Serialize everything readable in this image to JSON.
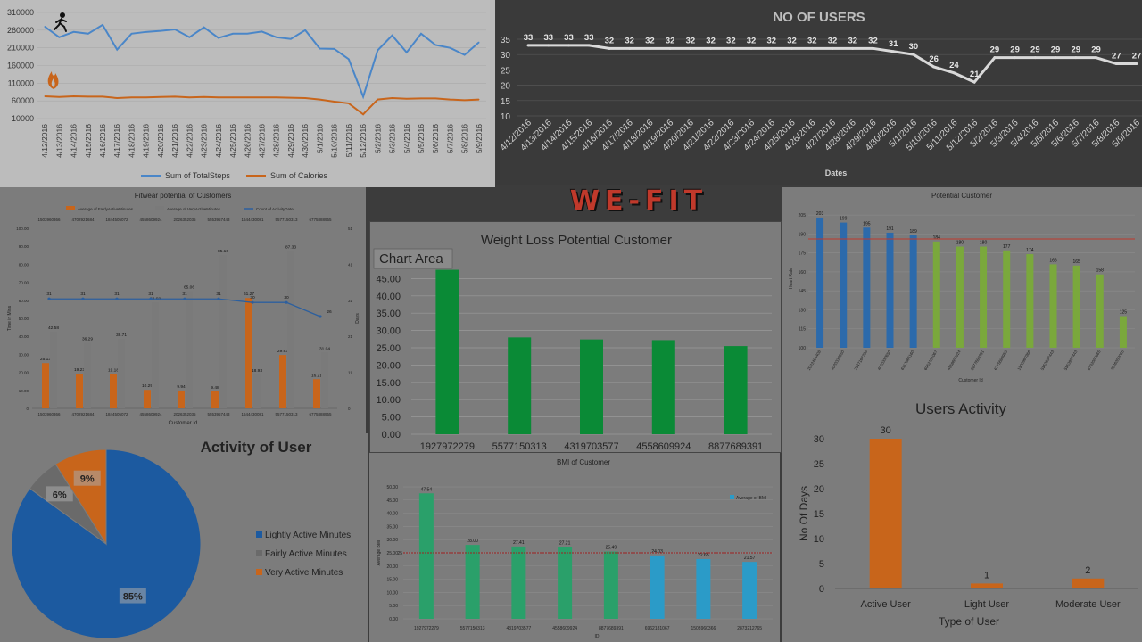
{
  "logo_text": "WE-FIT",
  "chart_data": [
    {
      "id": "steps_calories",
      "type": "line",
      "categories": [
        "4/12/2016",
        "4/13/2016",
        "4/14/2016",
        "4/15/2016",
        "4/16/2016",
        "4/17/2016",
        "4/18/2016",
        "4/19/2016",
        "4/20/2016",
        "4/21/2016",
        "4/22/2016",
        "4/23/2016",
        "4/24/2016",
        "4/25/2016",
        "4/26/2016",
        "4/27/2016",
        "4/28/2016",
        "4/29/2016",
        "4/30/2016",
        "5/1/2016",
        "5/10/2016",
        "5/11/2016",
        "5/12/2016",
        "5/2/2016",
        "5/3/2016",
        "5/4/2016",
        "5/5/2016",
        "5/6/2016",
        "5/7/2016",
        "5/8/2016",
        "5/9/2016"
      ],
      "series": [
        {
          "name": "Sum of TotalSteps",
          "color": "#4a86c8",
          "values": [
            270000,
            240000,
            255000,
            250000,
            275000,
            205000,
            250000,
            255000,
            258000,
            262000,
            240000,
            268000,
            238000,
            250000,
            250000,
            256000,
            240000,
            235000,
            260000,
            208000,
            207000,
            178000,
            72000,
            203000,
            245000,
            197000,
            250000,
            218000,
            210000,
            190000,
            226000
          ]
        },
        {
          "name": "Sum of Calories",
          "color": "#c8651b",
          "values": [
            73000,
            71000,
            73000,
            72000,
            72000,
            68000,
            70000,
            70000,
            71000,
            72000,
            70000,
            71000,
            70000,
            70000,
            70000,
            70000,
            70000,
            69000,
            68000,
            64000,
            58000,
            53000,
            22000,
            64000,
            68000,
            66000,
            67000,
            67000,
            64000,
            62000,
            64000
          ]
        }
      ],
      "y_ticks": [
        "10000",
        "60000",
        "110000",
        "160000",
        "210000",
        "260000",
        "310000"
      ],
      "ylim": [
        10000,
        310000
      ]
    },
    {
      "id": "users",
      "type": "line",
      "title": "NO OF USERS",
      "xlabel": "Dates",
      "categories": [
        "4/12/2016",
        "4/13/2016",
        "4/14/2016",
        "4/15/2016",
        "4/16/2016",
        "4/17/2016",
        "4/18/2016",
        "4/19/2016",
        "4/20/2016",
        "4/21/2016",
        "4/22/2016",
        "4/23/2016",
        "4/24/2016",
        "4/25/2016",
        "4/26/2016",
        "4/27/2016",
        "4/28/2016",
        "4/29/2016",
        "4/30/2016",
        "5/1/2016",
        "5/10/2016",
        "5/11/2016",
        "5/12/2016",
        "5/2/2016",
        "5/3/2016",
        "5/4/2016",
        "5/5/2016",
        "5/6/2016",
        "5/7/2016",
        "5/8/2016",
        "5/9/2016"
      ],
      "values": [
        33,
        33,
        33,
        33,
        32,
        32,
        32,
        32,
        32,
        32,
        32,
        32,
        32,
        32,
        32,
        32,
        32,
        32,
        31,
        30,
        26,
        24,
        21,
        29,
        29,
        29,
        29,
        29,
        29,
        27,
        27
      ],
      "y_ticks": [
        "10",
        "15",
        "20",
        "25",
        "30",
        "35"
      ],
      "ylim": [
        10,
        35
      ]
    },
    {
      "id": "fitwear",
      "type": "bar",
      "title": "Fitwear potential of Customers",
      "xlabel": "Customer Id",
      "ylabel": "Time in Mins",
      "y2label": "Days",
      "categories": [
        "1503960366",
        "4702921684",
        "1844505072",
        "4558609924",
        "2026352035",
        "5553957443",
        "1644430081",
        "5577150313",
        "6775888955"
      ],
      "series": [
        {
          "name": "Average of FairlyActiveMinutes",
          "color": "#c8651b",
          "values": [
            25.13,
            19.23,
            19.18,
            10.29,
            9.94,
            9.48,
            61.27,
            29.63,
            16.21
          ]
        },
        {
          "name": "Average of VeryActiveMinutes",
          "color": "#7a7a7a",
          "values": [
            42.58,
            36.29,
            38.71,
            58.68,
            65.06,
            85.16,
            18.93,
            87.33,
            31.04
          ]
        },
        {
          "name": "Count of ActivityDate",
          "color": "#2c5f9e",
          "values": [
            31,
            31,
            31,
            31,
            31,
            31,
            30,
            30,
            26
          ]
        }
      ],
      "y_ticks": [
        "0",
        "10.00",
        "20.00",
        "30.00",
        "40.00",
        "50.00",
        "60.00",
        "70.00",
        "80.00",
        "90.00",
        "100.00"
      ],
      "y2_ticks": [
        "0",
        "11",
        "21",
        "31",
        "41",
        "51"
      ],
      "ylim": [
        0,
        100
      ]
    },
    {
      "id": "weightloss",
      "type": "bar",
      "title": "Weight Loss Potential Customer",
      "overlay_label": "Chart Area",
      "categories": [
        "1927972279",
        "5577150313",
        "4319703577",
        "4558609924",
        "8877689391"
      ],
      "values": [
        47.54,
        28.0,
        27.41,
        27.21,
        25.49
      ],
      "color": "#0a8a36",
      "y_ticks": [
        "0.00",
        "5.00",
        "10.00",
        "15.00",
        "20.00",
        "25.00",
        "30.00",
        "35.00",
        "40.00",
        "45.00"
      ],
      "ylim": [
        0,
        50
      ]
    },
    {
      "id": "heartrate",
      "type": "bar",
      "title": "Potential Customer",
      "xlabel": "Customer Id",
      "ylabel": "Heart Rate",
      "categories": [
        "2022484408",
        "4020332650",
        "2347167796",
        "4020332650",
        "6117666160",
        "6962181067",
        "4558609924",
        "8877689391",
        "6775888955",
        "1503960366",
        "5553957443",
        "5553957443",
        "8792009665",
        "2026352035"
      ],
      "values": [
        203,
        199,
        195,
        191,
        189,
        184,
        180,
        180,
        177,
        174,
        166,
        165,
        158,
        125
      ],
      "colors": [
        "#2c6aab",
        "#2c6aab",
        "#2c6aab",
        "#2c6aab",
        "#2c6aab",
        "#7aa83c",
        "#7aa83c",
        "#7aa83c",
        "#7aa83c",
        "#7aa83c",
        "#7aa83c",
        "#7aa83c",
        "#7aa83c",
        "#7aa83c"
      ],
      "y_ticks": [
        "100",
        "115",
        "130",
        "145",
        "160",
        "175",
        "190",
        "205"
      ],
      "ylim": [
        100,
        210
      ],
      "reference": 186
    },
    {
      "id": "activity_pie",
      "type": "pie",
      "title": "Activity of User",
      "slices": [
        {
          "label": "Lightly Active Minutes",
          "value": 85,
          "text": "85%",
          "color": "#1c5aa0"
        },
        {
          "label": "Fairly Active Minutes",
          "value": 6,
          "text": "6%",
          "color": "#6a6a6a"
        },
        {
          "label": "Very Active Minutes",
          "value": 9,
          "text": "9%",
          "color": "#c8651b"
        }
      ]
    },
    {
      "id": "bmi",
      "type": "bar",
      "title": "BMI of Customer",
      "xlabel": "ID",
      "ylabel": "Average BMI",
      "legend": "Average of BMI",
      "categories": [
        "1927972279",
        "5577150313",
        "4319703577",
        "4558609924",
        "8877689391",
        "6962181067",
        "1503960366",
        "2873212765"
      ],
      "values": [
        47.54,
        28.0,
        27.41,
        27.21,
        25.49,
        24.03,
        22.65,
        21.57
      ],
      "labels": [
        "47.54",
        "28.00",
        "27.41",
        "27.21",
        "25.49",
        "24.03",
        "22.65",
        "21.57"
      ],
      "colors": [
        "#2aa06a",
        "#2aa06a",
        "#2aa06a",
        "#2aa06a",
        "#2aa06a",
        "#2b9bc8",
        "#2b9bc8",
        "#2b9bc8"
      ],
      "y_ticks": [
        "0.00",
        "5.00",
        "10.00",
        "15.00",
        "20.00",
        "25.00",
        "30.00",
        "35.00",
        "40.00",
        "45.00",
        "50.00"
      ],
      "ylim": [
        0,
        50
      ],
      "reference": 25,
      "reference_label": "25"
    },
    {
      "id": "users_activity",
      "type": "bar",
      "title": "Users  Activity",
      "xlabel": "Type of User",
      "ylabel": "No Of Days",
      "categories": [
        "Active User",
        "Light User",
        "Moderate User"
      ],
      "values": [
        30,
        1,
        2
      ],
      "color": "#c8651b",
      "y_ticks": [
        "0",
        "5",
        "10",
        "15",
        "20",
        "25",
        "30"
      ],
      "ylim": [
        0,
        30
      ]
    }
  ]
}
